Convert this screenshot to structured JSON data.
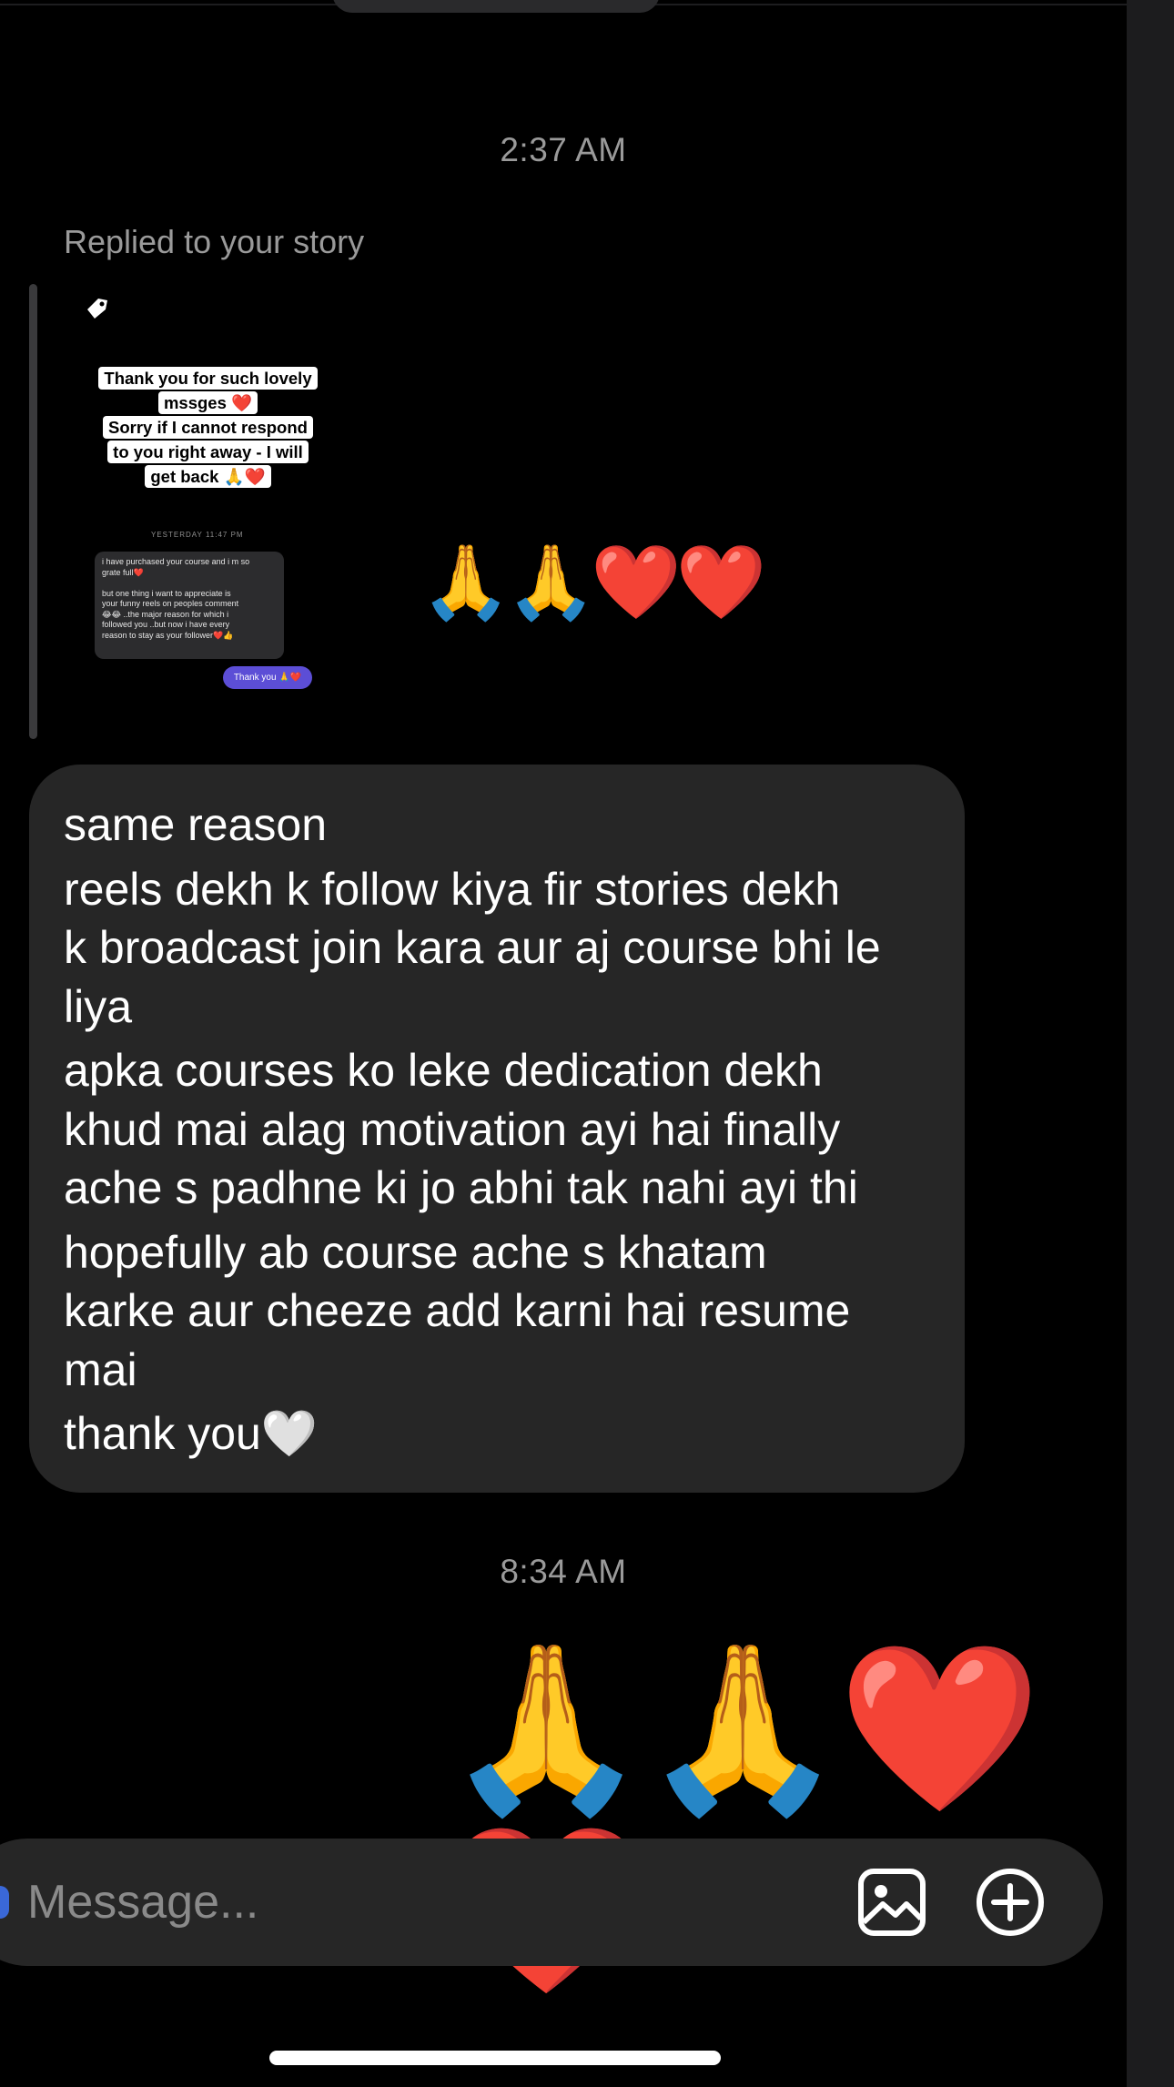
{
  "chat": {
    "timestamp_1": "2:37 AM",
    "replied_label": "Replied to your story",
    "story": {
      "caption_lines": [
        "Thank you for such lovely",
        "mssges ❤️",
        "Sorry if I cannot respond",
        "to you right away - I will",
        "get back 🙏❤️"
      ],
      "yesterday_label": "YESTERDAY 11:47 PM",
      "dm_text": "i have purchased your course and i m so\ngrate full❤️\n\nbut one thing i want to appreciate is\nyour funny reels on peoples comment\n😂😂 ..the major reason for which i\nfollowed you ..but now i have every\nreason to stay as your follower❤️👍",
      "reply_pill": "Thank you 🙏❤️"
    },
    "story_reaction": "🙏🙏❤️❤️",
    "message_lines": [
      "same reason",
      "reels dekh k follow kiya fir stories dekh",
      "k broadcast join kara aur aj course bhi le",
      "liya",
      "apka courses ko leke dedication dekh",
      "khud mai alag motivation ayi hai finally",
      "ache s padhne ki jo abhi tak nahi ayi thi",
      "hopefully ab course ache s khatam",
      "karke aur cheeze add karni hai resume",
      "mai",
      "thank you🤍"
    ],
    "timestamp_2": "8:34 AM",
    "sent_reaction": "🙏🙏❤️❤️"
  },
  "composer": {
    "placeholder": "Message...",
    "gallery_icon": "image-icon",
    "plus_icon": "plus-circle-icon"
  },
  "colors": {
    "background": "#000000",
    "bubble": "#262626",
    "muted_text": "#9a9a9a",
    "accent": "#5c4ed6"
  }
}
